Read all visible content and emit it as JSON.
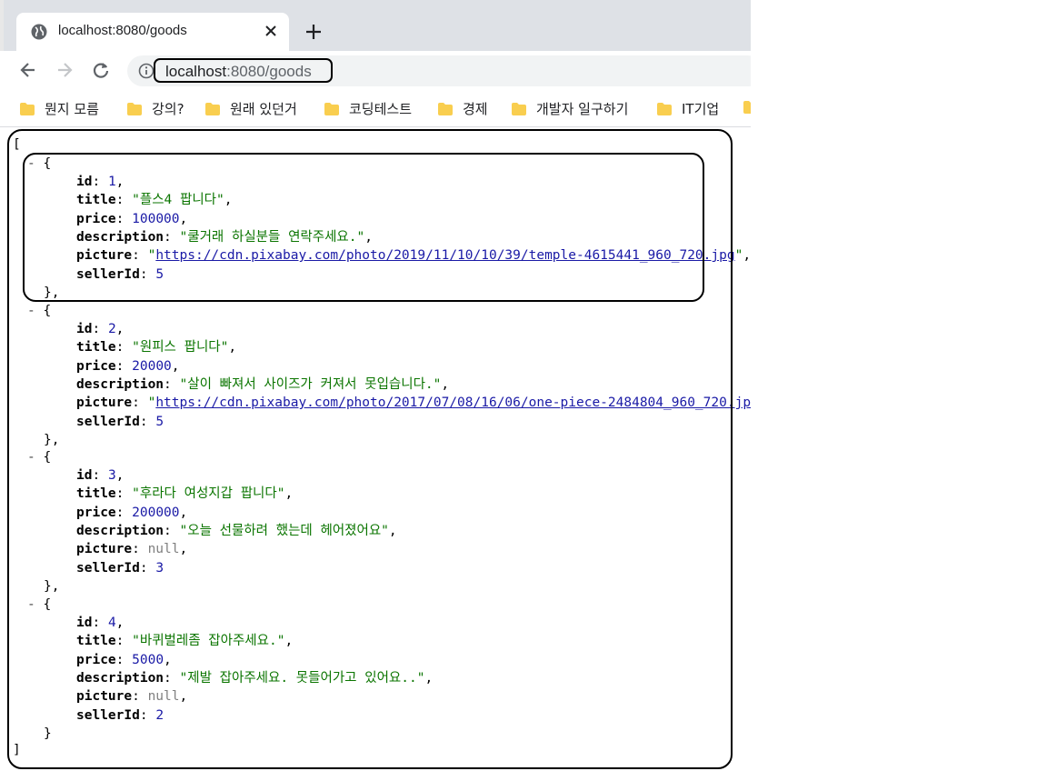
{
  "tab": {
    "title": "localhost:8080/goods",
    "favicon": "globe-icon"
  },
  "address": {
    "host": "localhost",
    "path": ":8080/goods"
  },
  "bookmarks": [
    "뭔지 모름",
    "강의?",
    "원래 있던거",
    "코딩테스트",
    "경제",
    "개발자 일구하기",
    "IT기업"
  ],
  "colors": {
    "number": "#1a1aa6",
    "string": "#0b7500",
    "null": "#808080",
    "folder": "#f9ce4f"
  },
  "json": {
    "open": "[",
    "close": "]",
    "toggle": "-",
    "items": [
      {
        "id": "1",
        "title": "\"플스4 팝니다\"",
        "price": "100000",
        "description": "\"쿨거래 하실분들 연락주세요.\"",
        "picture": "https://cdn.pixabay.com/photo/2019/11/10/10/39/temple-4615441_960_720.jpg",
        "picture_null": false,
        "sellerId": "5"
      },
      {
        "id": "2",
        "title": "\"원피스 팝니다\"",
        "price": "20000",
        "description": "\"살이 빠져서 사이즈가 커져서 못입습니다.\"",
        "picture": "https://cdn.pixabay.com/photo/2017/07/08/16/06/one-piece-2484804_960_720.jpg",
        "picture_null": false,
        "sellerId": "5"
      },
      {
        "id": "3",
        "title": "\"후라다 여성지갑 팝니다\"",
        "price": "200000",
        "description": "\"오늘 선물하려 했는데 헤어졌어요\"",
        "picture": "null",
        "picture_null": true,
        "sellerId": "3"
      },
      {
        "id": "4",
        "title": "\"바퀴벌레좀 잡아주세요.\"",
        "price": "5000",
        "description": "\"제발 잡아주세요. 못들어가고 있어요..\"",
        "picture": "null",
        "picture_null": true,
        "sellerId": "2"
      }
    ]
  }
}
